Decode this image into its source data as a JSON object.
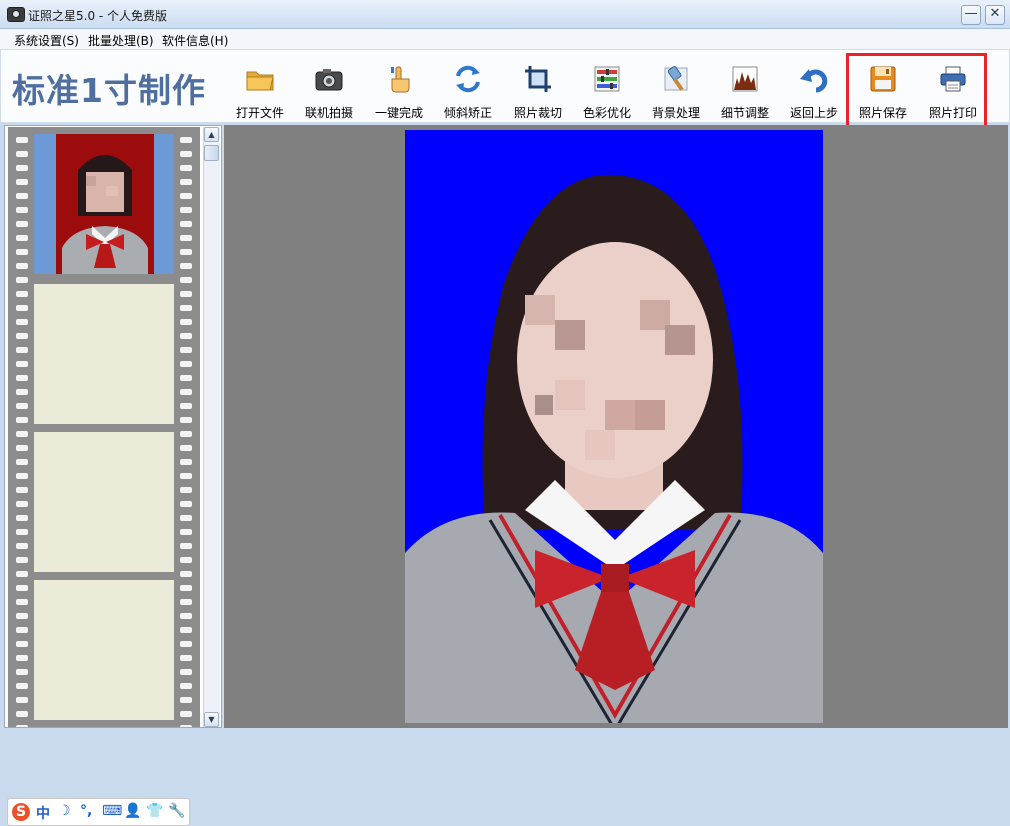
{
  "window": {
    "title": "证照之星5.0 - 个人免费版",
    "minimize_label": "—",
    "close_label": "✕"
  },
  "menu": [
    {
      "label": "系统设置(S)"
    },
    {
      "label": "批量处理(B)"
    },
    {
      "label": "软件信息(H)"
    }
  ],
  "toolbar": {
    "brand": "标准1寸制作",
    "buttons": [
      {
        "label": "打开文件",
        "icon": "folder-icon"
      },
      {
        "label": "联机拍摄",
        "icon": "camera-icon"
      },
      {
        "label": "一键完成",
        "icon": "click-hand-icon"
      },
      {
        "label": "倾斜矫正",
        "icon": "rotate-icon"
      },
      {
        "label": "照片裁切",
        "icon": "crop-icon"
      },
      {
        "label": "色彩优化",
        "icon": "color-adjust-icon"
      },
      {
        "label": "背景处理",
        "icon": "background-brush-icon"
      },
      {
        "label": "细节调整",
        "icon": "histogram-icon"
      },
      {
        "label": "返回上步",
        "icon": "undo-icon"
      },
      {
        "label": "照片保存",
        "icon": "floppy-save-icon"
      },
      {
        "label": "照片打印",
        "icon": "printer-icon"
      }
    ]
  },
  "ime": {
    "items": [
      "S",
      "中",
      "☽",
      "°,",
      "⌨",
      "👤",
      "👕",
      "🔧"
    ]
  },
  "colors": {
    "photo_background": "#0000fd",
    "thumbnail_background": "#9c0c0c",
    "highlight": "#e8242a",
    "brand": "#4e6f9f"
  }
}
